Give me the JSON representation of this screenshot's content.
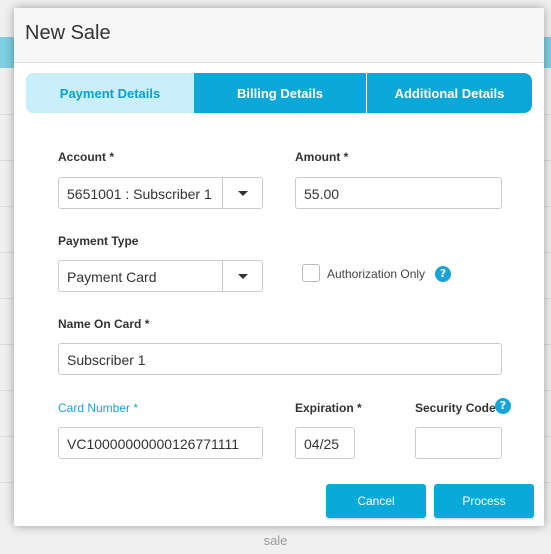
{
  "background": {
    "footer_text": "sale"
  },
  "modal": {
    "title": "New Sale",
    "tabs": [
      {
        "label": "Payment Details",
        "active": true
      },
      {
        "label": "Billing Details",
        "active": false
      },
      {
        "label": "Additional Details",
        "active": false
      }
    ],
    "form": {
      "account": {
        "label": "Account *",
        "value": "5651001 : Subscriber 1"
      },
      "amount": {
        "label": "Amount *",
        "value": "55.00"
      },
      "payment_type": {
        "label": "Payment Type",
        "value": "Payment Card"
      },
      "authorization_only": {
        "label": "Authorization Only",
        "checked": false
      },
      "name_on_card": {
        "label": "Name On Card *",
        "value": "Subscriber 1"
      },
      "card_number": {
        "label": "Card Number *",
        "value": "VC10000000000126771111"
      },
      "expiration": {
        "label": "Expiration *",
        "value": "04/25"
      },
      "security_code": {
        "label": "Security Code",
        "value": ""
      }
    },
    "help_glyph": "?",
    "buttons": {
      "cancel": "Cancel",
      "process": "Process"
    }
  },
  "colors": {
    "accent": "#09a9d9",
    "tab_active_bg": "#c9effa",
    "tab_active_text": "#0a9fd0",
    "label_accent": "#1aa3d8"
  },
  "icons": {
    "dropdown": "chevron-down-icon",
    "help": "help-icon"
  }
}
